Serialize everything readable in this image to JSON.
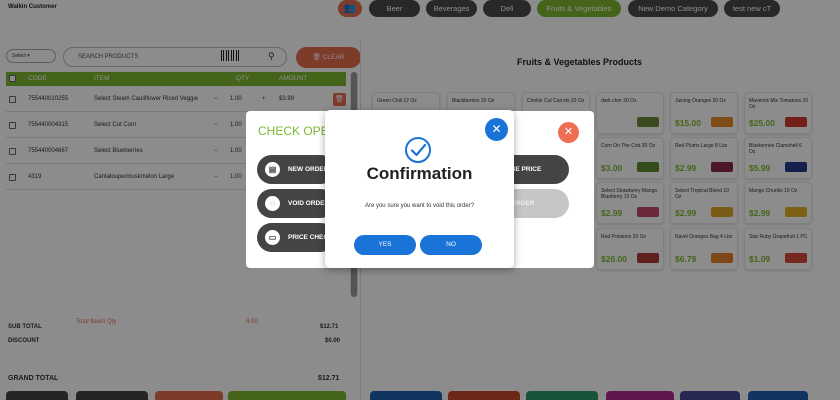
{
  "header": {
    "customer": "Walkin Customer",
    "categories": [
      {
        "label": "Beer",
        "active": false
      },
      {
        "label": "Beverages",
        "active": false
      },
      {
        "label": "Deli",
        "active": false
      },
      {
        "label": "Fruits & Vegetables",
        "active": true
      },
      {
        "label": "New Demo Category",
        "active": false
      },
      {
        "label": "test new cT",
        "active": false
      }
    ]
  },
  "search": {
    "select_label": "Select",
    "placeholder": "SEARCH PRODUCTS",
    "clear_label": "CLEAR"
  },
  "order_table": {
    "columns": [
      "CODE",
      "ITEM",
      "QTY",
      "AMOUNT"
    ],
    "rows": [
      {
        "code": "755440010255",
        "item": "Select Steam Cauliflower Riced Veggie",
        "qty": "1.00",
        "amount": "$3.99"
      },
      {
        "code": "755440004315",
        "item": "Select Cut Corn",
        "qty": "1.00",
        "amount": ""
      },
      {
        "code": "755440004667",
        "item": "Select Blueberries",
        "qty": "1.00",
        "amount": ""
      },
      {
        "code": "4319",
        "item": "Cantaloupe/muskmelon Large",
        "qty": "1.00",
        "amount": ""
      }
    ]
  },
  "totals": {
    "sub_total_label": "SUB TOTAL",
    "total_item_qty_label": "Total Iteam Qty",
    "total_item_qty": "4.00",
    "sub_total": "$12.71",
    "discount_label": "DISCOUNT",
    "discount": "$0.00",
    "grand_total_label": "GRAND TOTAL",
    "grand_total": "$12.71"
  },
  "products": {
    "title": "Fruits & Vegetables Products",
    "items": [
      {
        "name": "Green Chili 12 Oz",
        "price": ""
      },
      {
        "name": "Blackberries 20 Oz",
        "price": ""
      },
      {
        "name": "Crinkle Cut Carrots 20 Oz",
        "price": ""
      },
      {
        "name": "dark cher 20 Oz",
        "price": ""
      },
      {
        "name": "Juicing Oranges 20 Oz",
        "price": "$15.00"
      },
      {
        "name": "Maverick Mix Tomatoes 20 Oz",
        "price": "$25.00"
      },
      {
        "name": "Corn On The Cob 20 Oz",
        "price": "$3.00"
      },
      {
        "name": "Red Plums Large 8 Lbs",
        "price": "$2.99"
      },
      {
        "name": "Blueberries Clamshell 6 Oz",
        "price": "$5.99"
      },
      {
        "name": "Select Strawberry Mango Blueberry 10 Oz",
        "price": "$2.99"
      },
      {
        "name": "Select Tropical Blend 10 Oz",
        "price": "$2.99"
      },
      {
        "name": "Mango Chunks 10 Oz",
        "price": "$2.99"
      },
      {
        "name": "Red Potatoes 20 Oz",
        "price": "$20.00"
      },
      {
        "name": "Navel Oranges Bag 4 Lbs",
        "price": "$6.79"
      },
      {
        "name": "Star Ruby Grapefruit 1 PC",
        "price": "$1.09"
      }
    ]
  },
  "check_operations": {
    "title": "CHECK OPE",
    "new_order": "NEW ORDER",
    "void_order": "VOID ORDER",
    "price_check": "PRICE CHECK",
    "right_btn_1": "SE PRICE",
    "right_btn_2": "ORDER"
  },
  "confirmation": {
    "title": "Confirmation",
    "message": "Are you sure you want to void this order?",
    "yes": "YES",
    "no": "NO"
  },
  "colors": {
    "accent_green": "#7cb82f",
    "accent_red": "#e36c4e",
    "dialog_blue": "#1a73d6"
  }
}
